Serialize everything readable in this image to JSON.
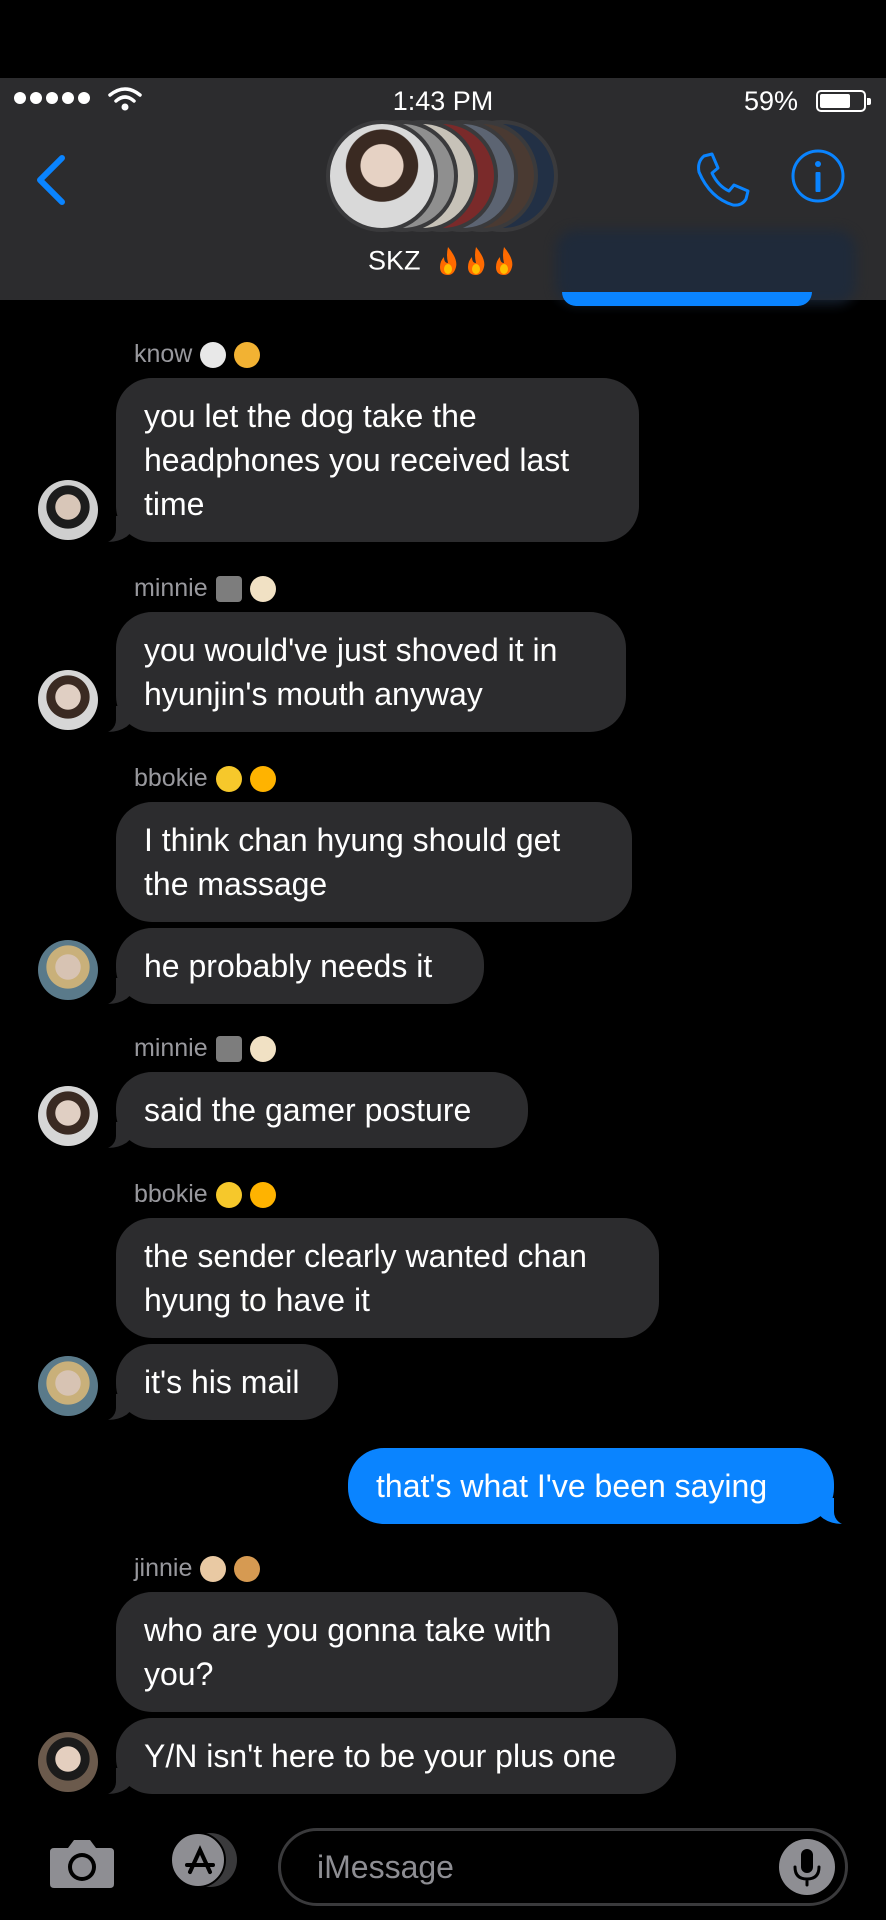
{
  "status_bar": {
    "time": "1:43 PM",
    "battery": "59%"
  },
  "header": {
    "group_name": "SKZ",
    "emoji_suffix": "🔥🔥🔥"
  },
  "colors": {
    "blue": "#0a84ff",
    "bubble_gray": "#2c2c2e",
    "header_bg": "#2c2c2e"
  },
  "messages": [
    {
      "sender": "know",
      "sender_emoji": "🐰🐱",
      "lines": [
        "you let the dog take the",
        "headphones you received last",
        "time"
      ]
    },
    {
      "sender": "minnie",
      "sender_emoji": "🎤🐶",
      "lines": [
        "you would've just shoved it in",
        "hyunjin's mouth anyway"
      ]
    },
    {
      "sender": "bbokie",
      "sender_emoji": "🐥☀️",
      "lines": [
        "I think chan hyung should get",
        "the massage"
      ]
    },
    {
      "lines": [
        "he probably needs it"
      ]
    },
    {
      "sender": "minnie",
      "sender_emoji": "🎤🐶",
      "lines": [
        "said the gamer posture"
      ]
    },
    {
      "sender": "bbokie",
      "sender_emoji": "🐥☀️",
      "lines": [
        "the sender clearly wanted chan",
        "hyung to have it"
      ]
    },
    {
      "lines": [
        "it's his mail"
      ]
    },
    {
      "outgoing": true,
      "lines": [
        "that's what I've been saying"
      ]
    },
    {
      "sender": "jinnie",
      "sender_emoji": "🐚🎨",
      "lines": [
        "who are you gonna take with",
        "you?"
      ]
    },
    {
      "lines": [
        "Y/N isn't here to be your plus one"
      ]
    }
  ],
  "composer": {
    "placeholder": "iMessage"
  }
}
